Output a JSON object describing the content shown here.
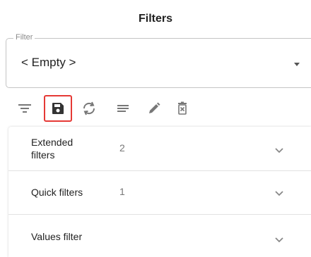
{
  "header": {
    "title": "Filters"
  },
  "filter_select": {
    "legend": "Filter",
    "value": "< Empty >"
  },
  "toolbar": {
    "buttons": [
      {
        "icon": "filter-list-icon"
      },
      {
        "icon": "save-icon",
        "selected": true
      },
      {
        "icon": "sync-icon"
      },
      {
        "icon": "notes-icon"
      },
      {
        "icon": "edit-icon"
      },
      {
        "icon": "delete-icon"
      }
    ]
  },
  "accordion": {
    "items": [
      {
        "label": "Extended filters",
        "count": "2"
      },
      {
        "label": "Quick filters",
        "count": "1"
      },
      {
        "label": "Values filter",
        "count": ""
      }
    ]
  },
  "colors": {
    "accent_selected": "#e53935",
    "icon": "#777777",
    "border": "#c4c4c4"
  }
}
